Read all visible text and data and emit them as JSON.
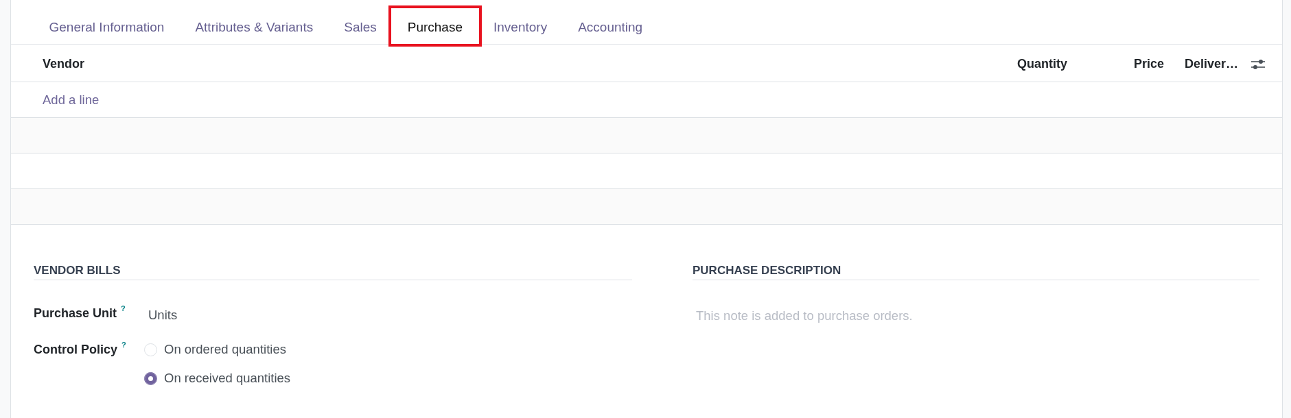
{
  "tabs": [
    {
      "label": "General Information",
      "selected": false
    },
    {
      "label": "Attributes & Variants",
      "selected": false
    },
    {
      "label": "Sales",
      "selected": false
    },
    {
      "label": "Purchase",
      "selected": true
    },
    {
      "label": "Inventory",
      "selected": false
    },
    {
      "label": "Accounting",
      "selected": false
    }
  ],
  "vendor_table": {
    "columns": [
      "Vendor",
      "Quantity",
      "Price",
      "Deliver…"
    ],
    "add_line": "Add a line"
  },
  "vendor_bills": {
    "title": "VENDOR BILLS",
    "fields": [
      {
        "kind": "text",
        "label": "Purchase Unit",
        "help": "?",
        "value": "Units"
      },
      {
        "kind": "radio",
        "label": "Control Policy",
        "help": "?",
        "options": [
          {
            "label": "On ordered quantities",
            "selected": false
          },
          {
            "label": "On received quantities",
            "selected": true
          }
        ]
      }
    ]
  },
  "purchase_description": {
    "title": "PURCHASE DESCRIPTION",
    "placeholder": "This note is added to purchase orders."
  }
}
